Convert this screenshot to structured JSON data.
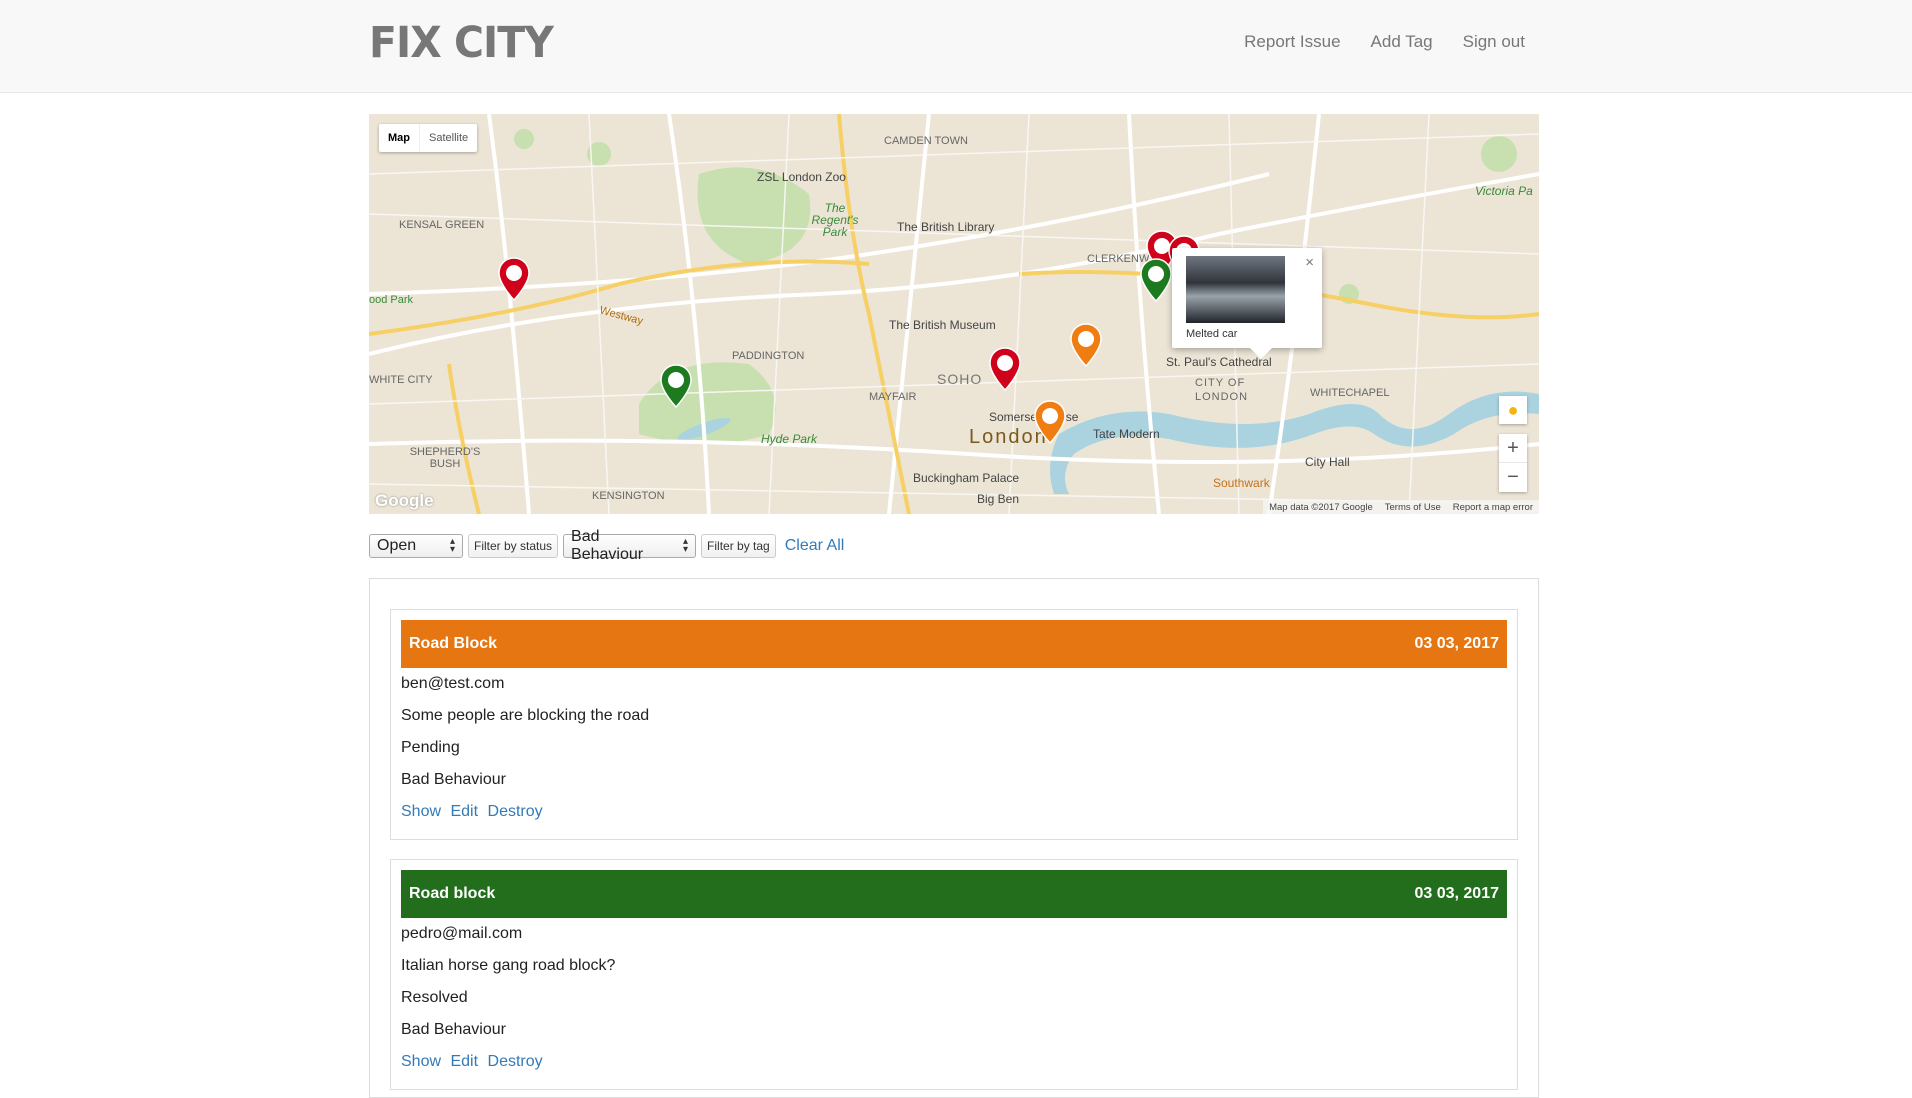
{
  "app": {
    "brand": "FIX CITY"
  },
  "nav": {
    "links": [
      "Report Issue",
      "Add Tag",
      "Sign out"
    ]
  },
  "map": {
    "type_controls": {
      "map": "Map",
      "satellite": "Satellite"
    },
    "labels": {
      "camden": "CAMDEN TOWN",
      "zoo": "ZSL London Zoo",
      "regents": "The Regent's Park",
      "library": "The British Library",
      "clerkenwell": "CLERKENWELL",
      "kensal": "KENSAL GREEN",
      "museum": "The British Museum",
      "paddington": "PADDINGTON",
      "soho": "SOHO",
      "mayfair": "MAYFAIR",
      "london": "London",
      "somerset": "Somerset House",
      "tate": "Tate Modern",
      "stpauls": "St. Paul's Cathedral",
      "city": "CITY OF LONDON",
      "whitechapel": "WHITECHAPEL",
      "whitecity": "WHITE CITY",
      "shepherds": "SHEPHERD'S BUSH",
      "hydepark": "Hyde Park",
      "kensington": "KENSINGTON",
      "buckingham": "Buckingham Palace",
      "bigben": "Big Ben",
      "southwark": "Southwark",
      "cityhall": "City Hall",
      "victoria": "Victoria Pa",
      "westway": "Westway",
      "wood": "ood Park"
    },
    "infowindow": {
      "caption": "Melted car",
      "close": "×"
    },
    "zoom": {
      "in": "+",
      "out": "−"
    },
    "google": "Google",
    "attribution": [
      "Map data ©2017 Google",
      "Terms of Use",
      "Report a map error"
    ],
    "colors": {
      "red": "#d0021b",
      "green": "#1e7a1e",
      "orange": "#ef7d12"
    }
  },
  "filters": {
    "status_value": "Open",
    "status_button": "Filter by status",
    "tag_value": "Bad Behaviour",
    "tag_button": "Filter by tag",
    "clear": "Clear All"
  },
  "issues": [
    {
      "title": "Road Block",
      "date": "03 03, 2017",
      "email": "ben@test.com",
      "description": "Some people are blocking the road",
      "status": "Pending",
      "tag": "Bad Behaviour",
      "color": "#e57611",
      "actions": {
        "show": "Show",
        "edit": "Edit",
        "destroy": "Destroy"
      }
    },
    {
      "title": "Road block",
      "date": "03 03, 2017",
      "email": "pedro@mail.com",
      "description": "Italian horse gang road block?",
      "status": "Resolved",
      "tag": "Bad Behaviour",
      "color": "#236e1c",
      "actions": {
        "show": "Show",
        "edit": "Edit",
        "destroy": "Destroy"
      }
    }
  ]
}
